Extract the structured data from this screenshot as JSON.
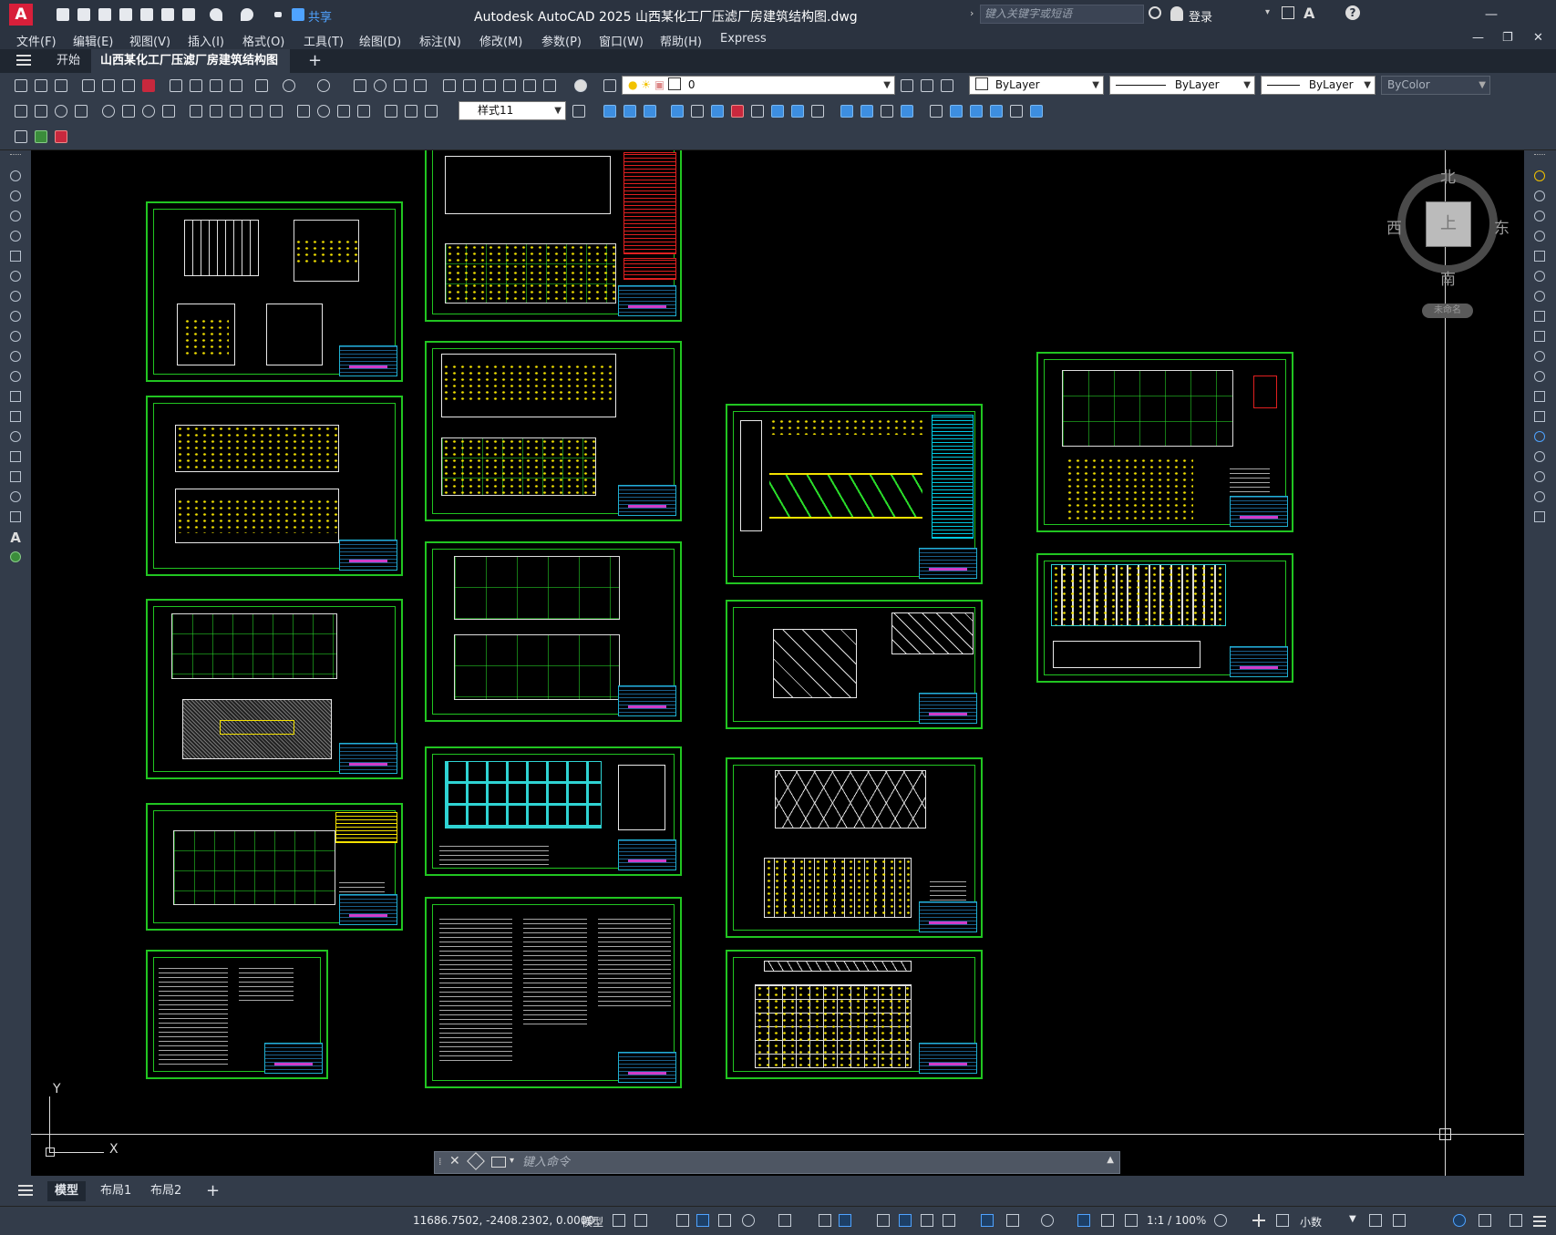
{
  "app": {
    "logo": "A",
    "title": "Autodesk AutoCAD 2025    山西某化工厂压滤厂房建筑结构图.dwg",
    "search_placeholder": "键入关键字或短语",
    "share_label": "共享",
    "login_label": "登录"
  },
  "window_controls": {
    "minimize": "—",
    "maximize": "☐",
    "close": "✕"
  },
  "menu": [
    "文件(F)",
    "编辑(E)",
    "视图(V)",
    "插入(I)",
    "格式(O)",
    "工具(T)",
    "绘图(D)",
    "标注(N)",
    "修改(M)",
    "参数(P)",
    "窗口(W)",
    "帮助(H)",
    "Express"
  ],
  "doc_controls": {
    "minimize": "—",
    "restore": "❐",
    "close": "✕"
  },
  "tabs": {
    "home": "开始",
    "active": "山西某化工厂压滤厂房建筑结构图*",
    "new": "+"
  },
  "toolbar": {
    "layer_value": "0",
    "color_value": "ByLayer",
    "linetype_value": "ByLayer",
    "lineweight_value": "ByLayer",
    "plotstyle_value": "ByColor",
    "dimstyle_value": "样式11"
  },
  "viewcube": {
    "north": "北",
    "south": "南",
    "east": "东",
    "west": "西",
    "face": "上",
    "wcs": "未命名"
  },
  "ucs": {
    "x": "X",
    "y": "Y"
  },
  "command": {
    "placeholder": "键入命令"
  },
  "layout_tabs": [
    "模型",
    "布局1",
    "布局2"
  ],
  "status": {
    "coordinates": "11686.7502, -2408.2302, 0.0000",
    "model_label": "模型",
    "scale": "1:1 / 100%",
    "units": "小数"
  },
  "colors": {
    "frame": "#21c521",
    "canvas": "#000000",
    "ui": "#333c4a",
    "accent": "#d81f3a"
  }
}
